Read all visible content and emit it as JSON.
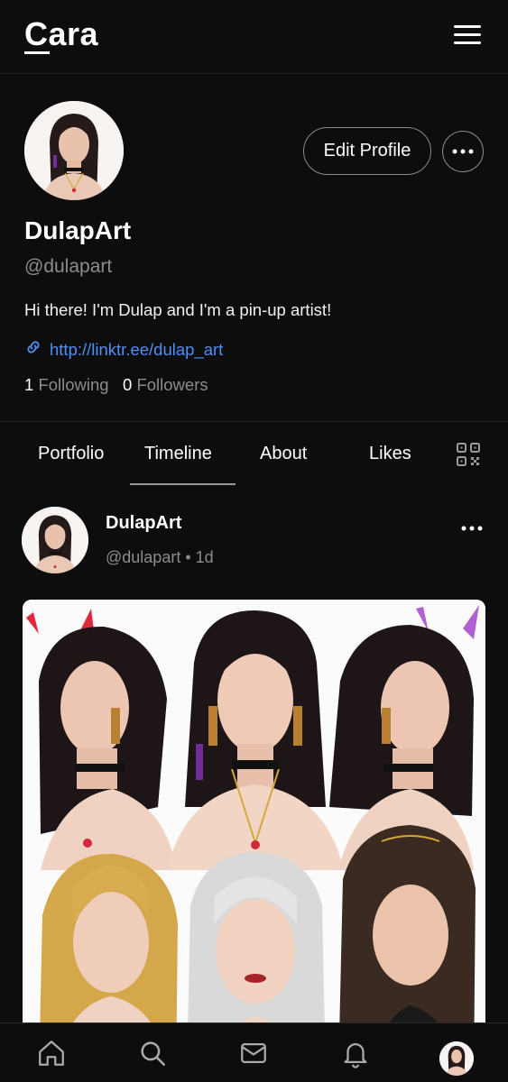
{
  "app": {
    "logo": "Cara"
  },
  "profile": {
    "display_name": "DulapArt",
    "handle": "@dulapart",
    "bio": "Hi there! I'm Dulap and I'm a pin-up artist!",
    "link": "http://linktr.ee/dulap_art",
    "following_count": "1",
    "following_label": "Following",
    "followers_count": "0",
    "followers_label": "Followers",
    "edit_label": "Edit Profile"
  },
  "tabs": [
    {
      "label": "Portfolio"
    },
    {
      "label": "Timeline",
      "active": true
    },
    {
      "label": "About"
    },
    {
      "label": "Likes"
    }
  ],
  "post": {
    "author": "DulapArt",
    "handle": "@dulapart",
    "separator": "•",
    "time": "1d"
  },
  "icons": {
    "menu": "hamburger-menu-icon",
    "more": "more-horizontal-icon",
    "link": "link-icon",
    "qr": "qr-code-icon",
    "nav": [
      "home-icon",
      "search-icon",
      "mail-icon",
      "bell-icon",
      "profile-avatar"
    ]
  },
  "colors": {
    "background": "#0d0d0d",
    "link": "#4e8ff8",
    "muted": "#8c8c8c",
    "border": "#8a8a8a"
  }
}
